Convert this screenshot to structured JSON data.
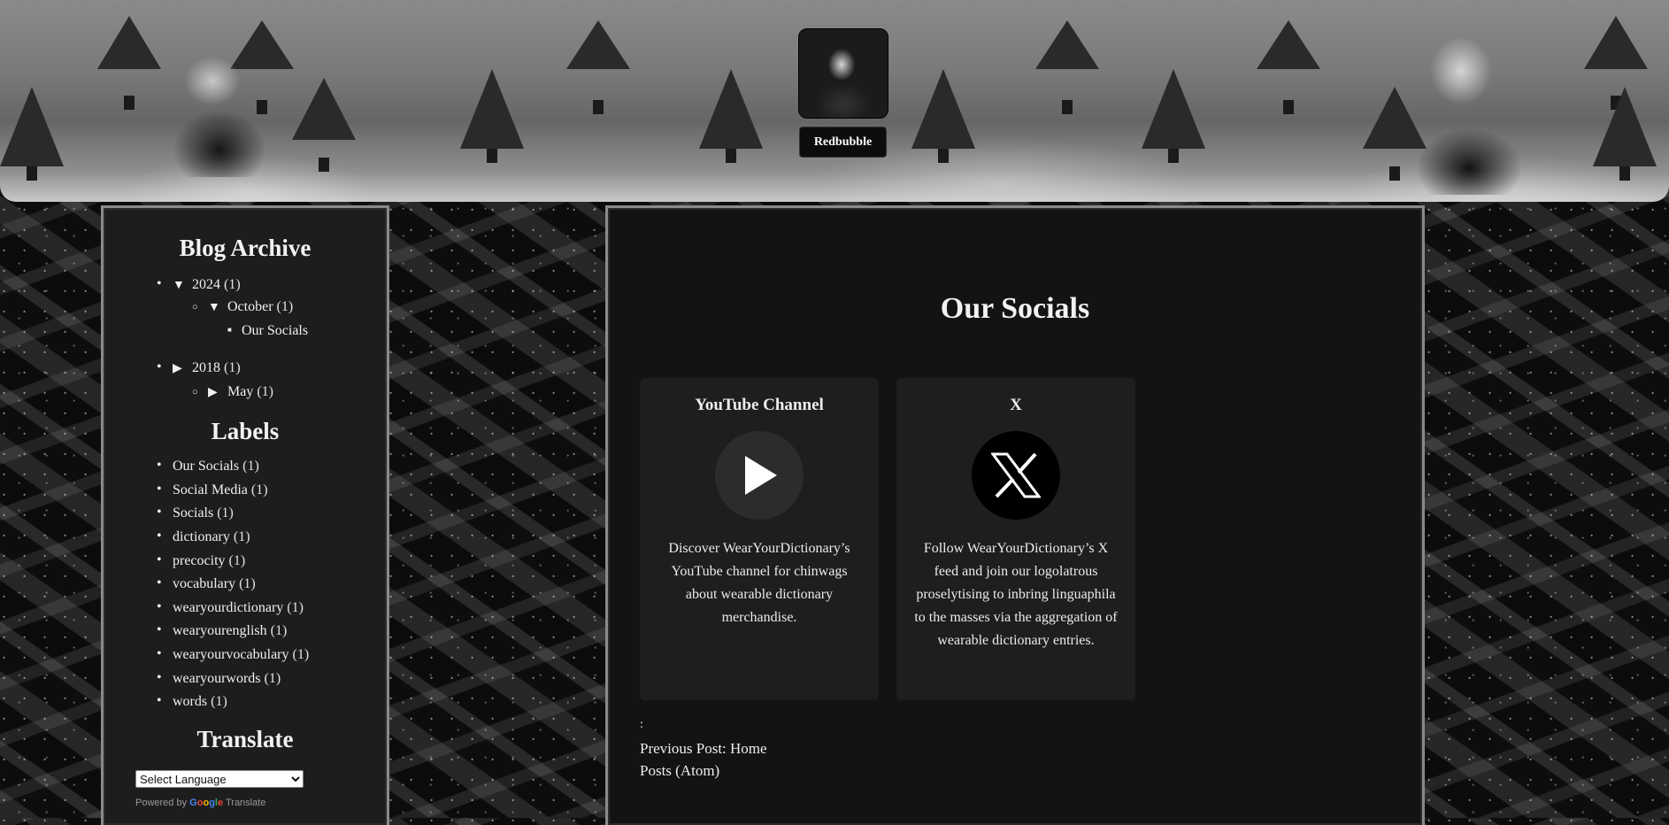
{
  "header": {
    "redbubble_label": "Redbubble"
  },
  "sidebar": {
    "archive_title": "Blog Archive",
    "archive": [
      {
        "label": "2024",
        "count": "(1)"
      },
      {
        "label": "October",
        "count": "(1)"
      },
      {
        "label": "Our Socials"
      },
      {
        "label": "2018",
        "count": "(1)"
      },
      {
        "label": "May",
        "count": "(1)"
      }
    ],
    "labels_title": "Labels",
    "labels": [
      {
        "label": "Our Socials",
        "count": "(1)"
      },
      {
        "label": "Social Media",
        "count": "(1)"
      },
      {
        "label": "Socials",
        "count": "(1)"
      },
      {
        "label": "dictionary",
        "count": "(1)"
      },
      {
        "label": "precocity",
        "count": "(1)"
      },
      {
        "label": "vocabulary",
        "count": "(1)"
      },
      {
        "label": "wearyourdictionary",
        "count": "(1)"
      },
      {
        "label": "wearyourenglish",
        "count": "(1)"
      },
      {
        "label": "wearyourvocabulary",
        "count": "(1)"
      },
      {
        "label": "wearyourwords",
        "count": "(1)"
      },
      {
        "label": "words",
        "count": "(1)"
      }
    ],
    "translate_title": "Translate",
    "language_select": "Select Language",
    "powered_by": "Powered by",
    "google": [
      "G",
      "o",
      "o",
      "g",
      "l",
      "e"
    ],
    "translate_word": "Translate"
  },
  "main": {
    "post_title": "Our Socials",
    "cards": [
      {
        "title": "YouTube Channel",
        "icon": "play-icon",
        "text": "Discover WearYourDictionary’s YouTube channel for chinwags about wearable dictionary merchandise."
      },
      {
        "title": "X",
        "icon": "x-logo-icon",
        "text": "Follow WearYourDictionary’s X feed and join our logolatrous proselytising to inbring linguaphila to the masses via the aggregation of wearable dictionary entries."
      }
    ],
    "separator": ":",
    "previous_post": "Previous Post: Home",
    "posts_feed": "Posts (Atom)"
  }
}
